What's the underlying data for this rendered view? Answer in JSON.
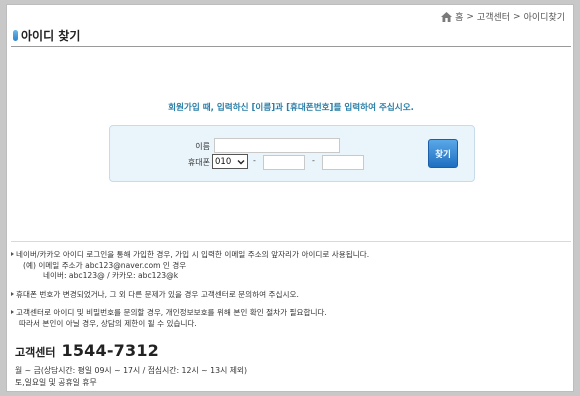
{
  "breadcrumb": {
    "items": [
      "홈",
      "고객센터",
      "아이디찾기"
    ],
    "sep": ">"
  },
  "page": {
    "title": "아이디 찾기"
  },
  "instruction": "회원가입 때, 입력하신 [이름]과 [휴대폰번호]를 입력하여 주십시오.",
  "form": {
    "name_label": "이름",
    "name_value": "",
    "phone_label": "휴대폰",
    "phone_prefix_selected": "010",
    "phone_sep": "-",
    "phone_middle": "",
    "phone_last": "",
    "submit_label": "찾기"
  },
  "notes": [
    {
      "lines": [
        {
          "text": "네이버/카카오 아이디 로그인을 통해 가입한 경우, 가입 시 입력한 이메일 주소의 앞자리가 아이디로 사용됩니다.",
          "indent": 0,
          "bullet": true
        },
        {
          "text": "(예) 이메일 주소가 abc123@naver.com 인 경우",
          "indent": 1,
          "bullet": false
        },
        {
          "text": "네이버: abc123@ / 카카오: abc123@k",
          "indent": 2,
          "bullet": false
        }
      ]
    },
    {
      "lines": [
        {
          "text": "휴대폰 번호가 변경되었거나, 그 외 다른 문제가 있을 경우 고객센터로 문의하여 주십시오.",
          "indent": 0,
          "bullet": true
        }
      ]
    },
    {
      "lines": [
        {
          "text": "고객센터로 아이디 및 비밀번호를 문의할 경우, 개인정보보호를 위해 본인 확인 절차가 필요합니다.",
          "indent": 0,
          "bullet": true
        },
        {
          "text": "따라서 본인이 아닐 경우, 상담의 제한이 될 수 있습니다.",
          "indent": 3,
          "bullet": false
        }
      ]
    }
  ],
  "call_center": {
    "label": "고객센터",
    "number": "1544-7312",
    "hours": [
      "월 ~ 금(상담시간: 평일 09시 ~ 17시 / 점심시간: 12시 ~ 13시 제외)",
      "토,일요일 및 공휴일 휴무"
    ]
  },
  "colors": {
    "accent": "#2a7fa8",
    "button": "#2f7fd0",
    "form_bg": "#eaf4fb"
  },
  "icons": {
    "home": "home-icon",
    "select_arrow": "chevron-down-icon"
  }
}
